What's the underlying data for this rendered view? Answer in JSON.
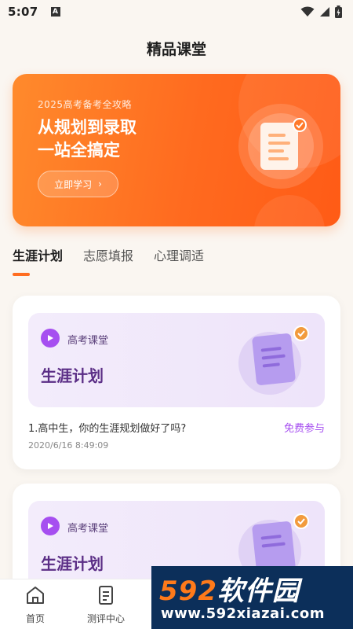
{
  "status": {
    "time": "5:07",
    "notif_letter": "A"
  },
  "header": {
    "title": "精品课堂"
  },
  "banner": {
    "subtitle": "2025高考备考全攻略",
    "title_line1": "从规划到录取",
    "title_line2": "一站全搞定",
    "button_label": "立即学习",
    "button_arrow": "›"
  },
  "tabs": [
    {
      "label": "生涯计划",
      "active": true
    },
    {
      "label": "志愿填报",
      "active": false
    },
    {
      "label": "心理调适",
      "active": false
    }
  ],
  "cards": [
    {
      "tag": "高考课堂",
      "big_title": "生涯计划",
      "desc": "1.高中生，你的生涯规划做好了吗?",
      "action": "免费参与",
      "time": "2020/6/16 8:49:09"
    },
    {
      "tag": "高考课堂",
      "big_title": "生涯计划"
    }
  ],
  "bottom_nav": [
    {
      "label": "首页",
      "icon": "home-icon"
    },
    {
      "label": "测评中心",
      "icon": "document-icon"
    }
  ],
  "watermark": {
    "brand_num": "592",
    "brand_text": "软件园",
    "url": "www.592xiazai.com"
  },
  "colors": {
    "accent_orange": "#ff6d21",
    "accent_purple": "#a64ff0"
  }
}
